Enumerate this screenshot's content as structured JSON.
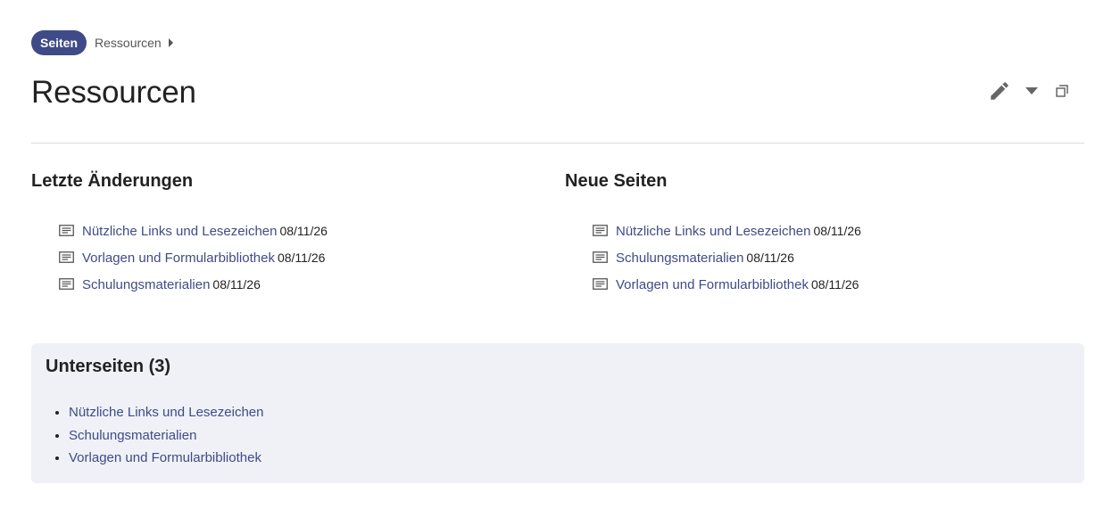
{
  "breadcrumb": {
    "root_label": "Seiten",
    "current_label": "Ressourcen"
  },
  "page": {
    "title": "Ressourcen"
  },
  "toolbar": {
    "edit_icon": "pencil-icon",
    "dropdown_icon": "caret-down-icon",
    "restore_icon": "window-restore-icon"
  },
  "recent_changes": {
    "heading": "Letzte Änderungen",
    "items": [
      {
        "title": "Nützliche Links und Lesezeichen",
        "date": "08/11/26"
      },
      {
        "title": "Vorlagen und Formularbibliothek",
        "date": "08/11/26"
      },
      {
        "title": "Schulungsmaterialien",
        "date": "08/11/26"
      }
    ]
  },
  "new_pages": {
    "heading": "Neue Seiten",
    "items": [
      {
        "title": "Nützliche Links und Lesezeichen",
        "date": "08/11/26"
      },
      {
        "title": "Schulungsmaterialien",
        "date": "08/11/26"
      },
      {
        "title": "Vorlagen und Formularbibliothek",
        "date": "08/11/26"
      }
    ]
  },
  "subpages": {
    "heading": "Unterseiten (3)",
    "items": [
      "Nützliche Links und Lesezeichen",
      "Schulungsmaterialien",
      "Vorlagen und Formularbibliothek"
    ]
  },
  "colors": {
    "accent": "#3f4b87",
    "panel_background": "#eff1f6",
    "divider": "#dddddd"
  }
}
